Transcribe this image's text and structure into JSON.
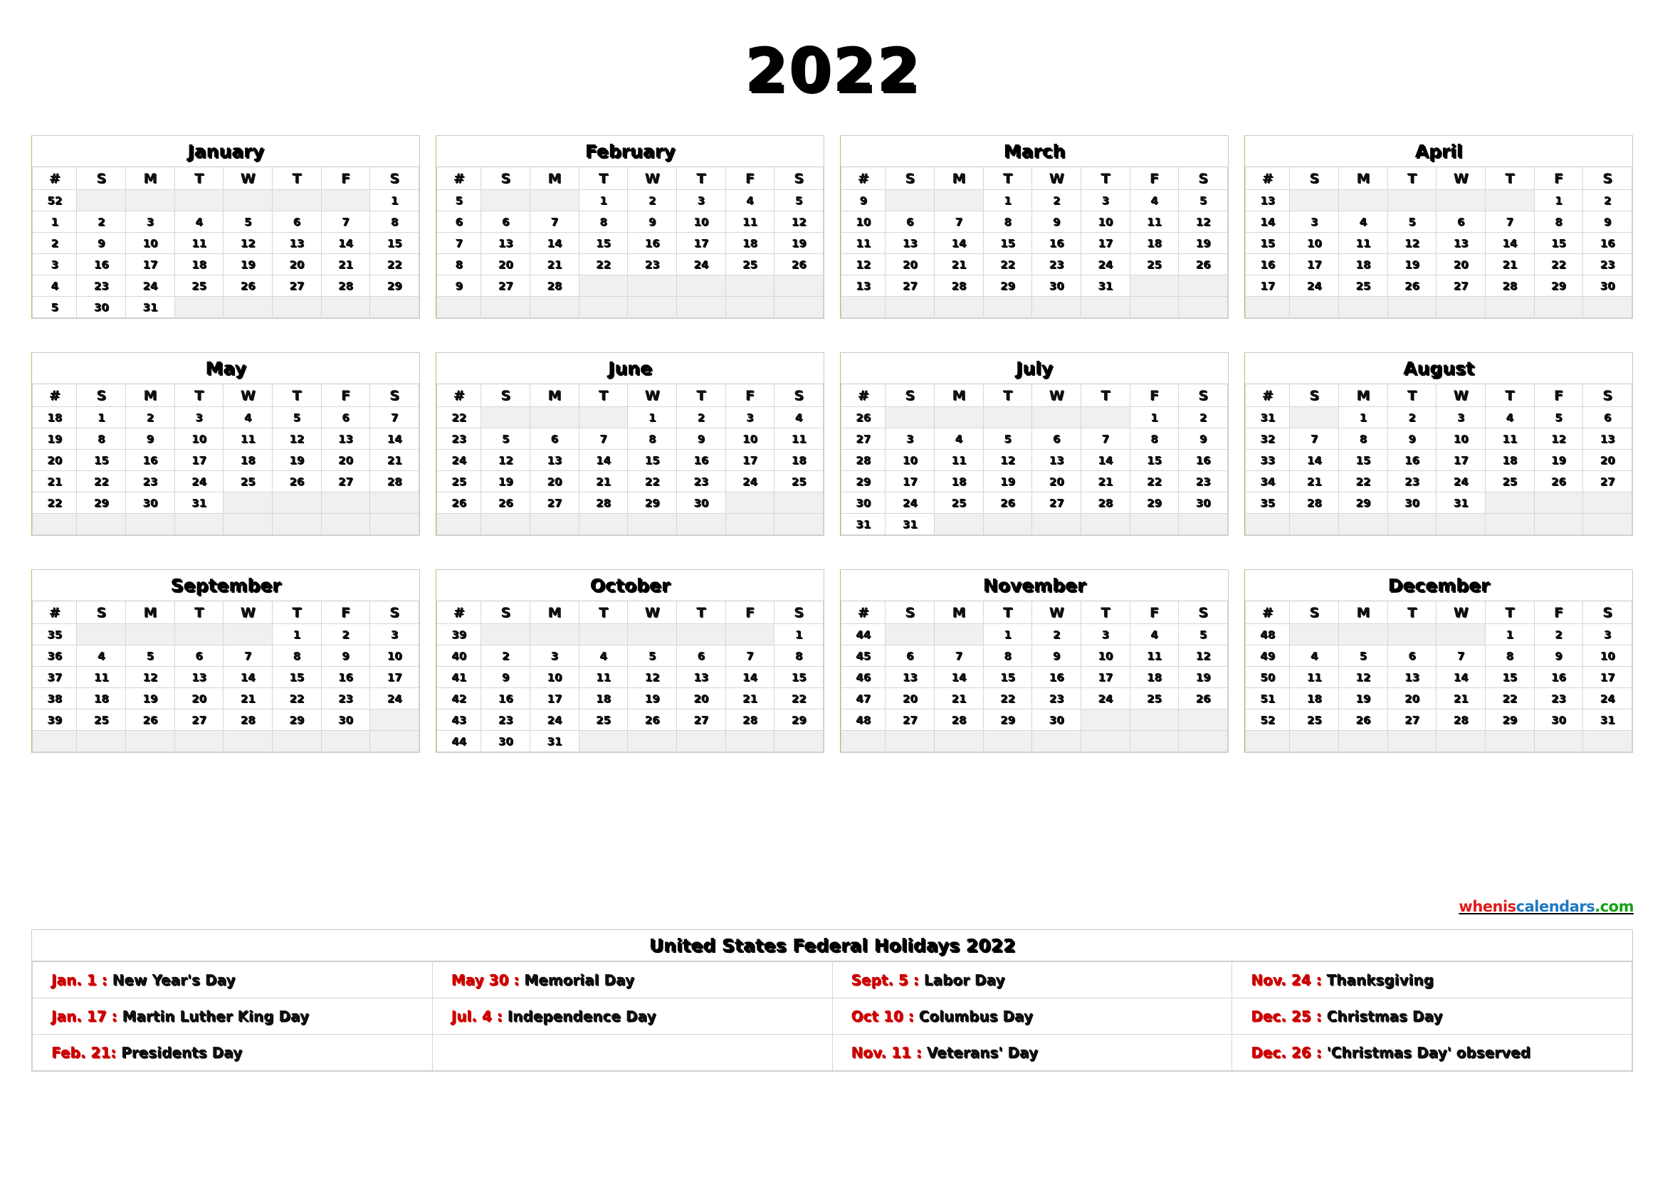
{
  "year_title": "2022",
  "colors": {
    "sunday": "#cc0000",
    "saturday": "#1f78c1",
    "holiday": "#cc0000",
    "weekday": "#111111",
    "empty_cell_bg": "#f0f0f0",
    "grid_line": "#d6d6d6",
    "box_border": "#c9c9c9",
    "accent_left_border": "#b5bf6a"
  },
  "weekday_headers": [
    "#",
    "S",
    "M",
    "T",
    "W",
    "T",
    "F",
    "S"
  ],
  "months": [
    {
      "name": "January",
      "weeks": [
        {
          "wk": "52",
          "days": [
            "",
            "",
            "",
            "",
            "",
            "",
            "1"
          ]
        },
        {
          "wk": "1",
          "days": [
            "2",
            "3",
            "4",
            "5",
            "6",
            "7",
            "8"
          ]
        },
        {
          "wk": "2",
          "days": [
            "9",
            "10",
            "11",
            "12",
            "13",
            "14",
            "15"
          ]
        },
        {
          "wk": "3",
          "days": [
            "16",
            "17",
            "18",
            "19",
            "20",
            "21",
            "22"
          ]
        },
        {
          "wk": "4",
          "days": [
            "23",
            "24",
            "25",
            "26",
            "27",
            "28",
            "29"
          ]
        },
        {
          "wk": "5",
          "days": [
            "30",
            "31",
            "",
            "",
            "",
            "",
            ""
          ]
        }
      ],
      "holidays": [
        "1",
        "17"
      ],
      "filler_rows": 0
    },
    {
      "name": "February",
      "weeks": [
        {
          "wk": "5",
          "days": [
            "",
            "",
            "1",
            "2",
            "3",
            "4",
            "5"
          ]
        },
        {
          "wk": "6",
          "days": [
            "6",
            "7",
            "8",
            "9",
            "10",
            "11",
            "12"
          ]
        },
        {
          "wk": "7",
          "days": [
            "13",
            "14",
            "15",
            "16",
            "17",
            "18",
            "19"
          ]
        },
        {
          "wk": "8",
          "days": [
            "20",
            "21",
            "22",
            "23",
            "24",
            "25",
            "26"
          ]
        },
        {
          "wk": "9",
          "days": [
            "27",
            "28",
            "",
            "",
            "",
            "",
            ""
          ]
        }
      ],
      "holidays": [
        "21"
      ],
      "filler_rows": 1
    },
    {
      "name": "March",
      "weeks": [
        {
          "wk": "9",
          "days": [
            "",
            "",
            "1",
            "2",
            "3",
            "4",
            "5"
          ]
        },
        {
          "wk": "10",
          "days": [
            "6",
            "7",
            "8",
            "9",
            "10",
            "11",
            "12"
          ]
        },
        {
          "wk": "11",
          "days": [
            "13",
            "14",
            "15",
            "16",
            "17",
            "18",
            "19"
          ]
        },
        {
          "wk": "12",
          "days": [
            "20",
            "21",
            "22",
            "23",
            "24",
            "25",
            "26"
          ]
        },
        {
          "wk": "13",
          "days": [
            "27",
            "28",
            "29",
            "30",
            "31",
            "",
            ""
          ]
        }
      ],
      "holidays": [],
      "filler_rows": 1
    },
    {
      "name": "April",
      "weeks": [
        {
          "wk": "13",
          "days": [
            "",
            "",
            "",
            "",
            "",
            "1",
            "2"
          ]
        },
        {
          "wk": "14",
          "days": [
            "3",
            "4",
            "5",
            "6",
            "7",
            "8",
            "9"
          ]
        },
        {
          "wk": "15",
          "days": [
            "10",
            "11",
            "12",
            "13",
            "14",
            "15",
            "16"
          ]
        },
        {
          "wk": "16",
          "days": [
            "17",
            "18",
            "19",
            "20",
            "21",
            "22",
            "23"
          ]
        },
        {
          "wk": "17",
          "days": [
            "24",
            "25",
            "26",
            "27",
            "28",
            "29",
            "30"
          ]
        }
      ],
      "holidays": [],
      "filler_rows": 1
    },
    {
      "name": "May",
      "weeks": [
        {
          "wk": "18",
          "days": [
            "1",
            "2",
            "3",
            "4",
            "5",
            "6",
            "7"
          ]
        },
        {
          "wk": "19",
          "days": [
            "8",
            "9",
            "10",
            "11",
            "12",
            "13",
            "14"
          ]
        },
        {
          "wk": "20",
          "days": [
            "15",
            "16",
            "17",
            "18",
            "19",
            "20",
            "21"
          ]
        },
        {
          "wk": "21",
          "days": [
            "22",
            "23",
            "24",
            "25",
            "26",
            "27",
            "28"
          ]
        },
        {
          "wk": "22",
          "days": [
            "29",
            "30",
            "31",
            "",
            "",
            "",
            ""
          ]
        }
      ],
      "holidays": [
        "30"
      ],
      "filler_rows": 1
    },
    {
      "name": "June",
      "weeks": [
        {
          "wk": "22",
          "days": [
            "",
            "",
            "",
            "1",
            "2",
            "3",
            "4"
          ]
        },
        {
          "wk": "23",
          "days": [
            "5",
            "6",
            "7",
            "8",
            "9",
            "10",
            "11"
          ]
        },
        {
          "wk": "24",
          "days": [
            "12",
            "13",
            "14",
            "15",
            "16",
            "17",
            "18"
          ]
        },
        {
          "wk": "25",
          "days": [
            "19",
            "20",
            "21",
            "22",
            "23",
            "24",
            "25"
          ]
        },
        {
          "wk": "26",
          "days": [
            "26",
            "27",
            "28",
            "29",
            "30",
            "",
            ""
          ]
        }
      ],
      "holidays": [],
      "filler_rows": 1
    },
    {
      "name": "July",
      "weeks": [
        {
          "wk": "26",
          "days": [
            "",
            "",
            "",
            "",
            "",
            "1",
            "2"
          ]
        },
        {
          "wk": "27",
          "days": [
            "3",
            "4",
            "5",
            "6",
            "7",
            "8",
            "9"
          ]
        },
        {
          "wk": "28",
          "days": [
            "10",
            "11",
            "12",
            "13",
            "14",
            "15",
            "16"
          ]
        },
        {
          "wk": "29",
          "days": [
            "17",
            "18",
            "19",
            "20",
            "21",
            "22",
            "23"
          ]
        },
        {
          "wk": "30",
          "days": [
            "24",
            "25",
            "26",
            "27",
            "28",
            "29",
            "30"
          ]
        },
        {
          "wk": "31",
          "days": [
            "31",
            "",
            "",
            "",
            "",
            "",
            ""
          ]
        }
      ],
      "holidays": [
        "4"
      ],
      "filler_rows": 0
    },
    {
      "name": "August",
      "weeks": [
        {
          "wk": "31",
          "days": [
            "",
            "1",
            "2",
            "3",
            "4",
            "5",
            "6"
          ]
        },
        {
          "wk": "32",
          "days": [
            "7",
            "8",
            "9",
            "10",
            "11",
            "12",
            "13"
          ]
        },
        {
          "wk": "33",
          "days": [
            "14",
            "15",
            "16",
            "17",
            "18",
            "19",
            "20"
          ]
        },
        {
          "wk": "34",
          "days": [
            "21",
            "22",
            "23",
            "24",
            "25",
            "26",
            "27"
          ]
        },
        {
          "wk": "35",
          "days": [
            "28",
            "29",
            "30",
            "31",
            "",
            "",
            ""
          ]
        }
      ],
      "holidays": [],
      "filler_rows": 1
    },
    {
      "name": "September",
      "weeks": [
        {
          "wk": "35",
          "days": [
            "",
            "",
            "",
            "",
            "1",
            "2",
            "3"
          ]
        },
        {
          "wk": "36",
          "days": [
            "4",
            "5",
            "6",
            "7",
            "8",
            "9",
            "10"
          ]
        },
        {
          "wk": "37",
          "days": [
            "11",
            "12",
            "13",
            "14",
            "15",
            "16",
            "17"
          ]
        },
        {
          "wk": "38",
          "days": [
            "18",
            "19",
            "20",
            "21",
            "22",
            "23",
            "24"
          ]
        },
        {
          "wk": "39",
          "days": [
            "25",
            "26",
            "27",
            "28",
            "29",
            "30",
            ""
          ]
        }
      ],
      "holidays": [
        "5"
      ],
      "filler_rows": 1
    },
    {
      "name": "October",
      "weeks": [
        {
          "wk": "39",
          "days": [
            "",
            "",
            "",
            "",
            "",
            "",
            "1"
          ]
        },
        {
          "wk": "40",
          "days": [
            "2",
            "3",
            "4",
            "5",
            "6",
            "7",
            "8"
          ]
        },
        {
          "wk": "41",
          "days": [
            "9",
            "10",
            "11",
            "12",
            "13",
            "14",
            "15"
          ]
        },
        {
          "wk": "42",
          "days": [
            "16",
            "17",
            "18",
            "19",
            "20",
            "21",
            "22"
          ]
        },
        {
          "wk": "43",
          "days": [
            "23",
            "24",
            "25",
            "26",
            "27",
            "28",
            "29"
          ]
        },
        {
          "wk": "44",
          "days": [
            "30",
            "31",
            "",
            "",
            "",
            "",
            ""
          ]
        }
      ],
      "holidays": [
        "10"
      ],
      "filler_rows": 0
    },
    {
      "name": "November",
      "weeks": [
        {
          "wk": "44",
          "days": [
            "",
            "",
            "1",
            "2",
            "3",
            "4",
            "5"
          ]
        },
        {
          "wk": "45",
          "days": [
            "6",
            "7",
            "8",
            "9",
            "10",
            "11",
            "12"
          ]
        },
        {
          "wk": "46",
          "days": [
            "13",
            "14",
            "15",
            "16",
            "17",
            "18",
            "19"
          ]
        },
        {
          "wk": "47",
          "days": [
            "20",
            "21",
            "22",
            "23",
            "24",
            "25",
            "26"
          ]
        },
        {
          "wk": "48",
          "days": [
            "27",
            "28",
            "29",
            "30",
            "",
            "",
            ""
          ]
        }
      ],
      "holidays": [
        "11",
        "24"
      ],
      "filler_rows": 1
    },
    {
      "name": "December",
      "weeks": [
        {
          "wk": "48",
          "days": [
            "",
            "",
            "",
            "",
            "1",
            "2",
            "3"
          ]
        },
        {
          "wk": "49",
          "days": [
            "4",
            "5",
            "6",
            "7",
            "8",
            "9",
            "10"
          ]
        },
        {
          "wk": "50",
          "days": [
            "11",
            "12",
            "13",
            "14",
            "15",
            "16",
            "17"
          ]
        },
        {
          "wk": "51",
          "days": [
            "18",
            "19",
            "20",
            "21",
            "22",
            "23",
            "24"
          ]
        },
        {
          "wk": "52",
          "days": [
            "25",
            "26",
            "27",
            "28",
            "29",
            "30",
            "31"
          ]
        }
      ],
      "holidays": [
        "25",
        "26"
      ],
      "filler_rows": 1
    }
  ],
  "holidays_panel": {
    "title": "United States Federal Holidays 2022",
    "columns": [
      [
        {
          "date": "Jan. 1 :",
          "name": "New Year's Day"
        },
        {
          "date": "Jan. 17 :",
          "name": "Martin Luther King Day"
        },
        {
          "date": "Feb. 21:",
          "name": "Presidents Day"
        }
      ],
      [
        {
          "date": "May 30 :",
          "name": "Memorial Day"
        },
        {
          "date": "Jul. 4 :",
          "name": "Independence Day"
        },
        {
          "date": "",
          "name": ""
        }
      ],
      [
        {
          "date": "Sept. 5 :",
          "name": "Labor Day"
        },
        {
          "date": "Oct 10 :",
          "name": "Columbus Day"
        },
        {
          "date": "Nov. 11 :",
          "name": "Veterans' Day"
        }
      ],
      [
        {
          "date": "Nov. 24 :",
          "name": "Thanksgiving"
        },
        {
          "date": "Dec. 25 :",
          "name": "Christmas Day"
        },
        {
          "date": "Dec. 26 :",
          "name": "'Christmas Day' observed"
        }
      ]
    ]
  },
  "watermark": {
    "part1": "whenis",
    "part2": "calendars",
    "part3": ".com"
  }
}
